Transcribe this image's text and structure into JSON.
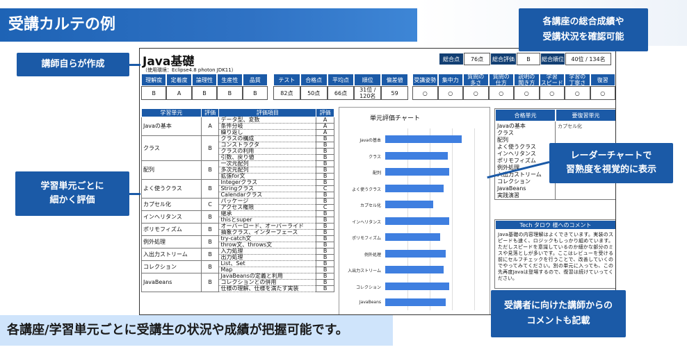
{
  "page": {
    "title": "受講カルテの例",
    "bottom_banner": "各講座/学習単元ごとに受講生の状況や成績が把握可能です。"
  },
  "callouts": {
    "instructor": "講師自らが作成",
    "overall": "各講座の総合成績や\n受講状況を確認可能",
    "per_unit": "学習単元ごとに\n細かく評価",
    "radar": "レーダーチャートで\n習熟度を視覚的に表示",
    "comment": "受講者に向けた講師からの\nコメントも記載"
  },
  "card": {
    "course_title": "Java基礎",
    "env_line": "（使用環境：Eclipse4.8 photon JDK11）",
    "summary": {
      "total_label": "総合点",
      "total_value": "76点",
      "eval_label": "総合評価",
      "eval_value": "B",
      "rank_label": "総合順位",
      "rank_value": "40位 / 134名"
    },
    "group1": {
      "headers": [
        "理解度",
        "定着度",
        "論理性",
        "生産性",
        "品質"
      ],
      "values": [
        "B",
        "A",
        "B",
        "B",
        "B"
      ]
    },
    "group2": {
      "headers": [
        "テスト",
        "合格点",
        "平均点",
        "順位",
        "偏差値"
      ],
      "values": [
        "82点",
        "50点",
        "66点",
        "31位 / 120名",
        "59"
      ]
    },
    "group3": {
      "headers": [
        "受講姿勢",
        "集中力",
        "質問の\n多さ",
        "質問の\n仕方",
        "説明の\n聞き方",
        "学習\nスピード",
        "学習の\n丁寧さ",
        "復習"
      ],
      "values": [
        "○",
        "○",
        "○",
        "○",
        "○",
        "○",
        "○",
        "○"
      ]
    },
    "units_table": {
      "headers": [
        "学習単元",
        "評価",
        "評価項目",
        "評価"
      ],
      "rows": [
        {
          "unit": "Javaの基本",
          "grade": "A",
          "items": [
            [
              "データ型、変数",
              "A"
            ],
            [
              "条件分岐",
              "A"
            ],
            [
              "繰り返し",
              "A"
            ]
          ]
        },
        {
          "unit": "クラス",
          "grade": "B",
          "items": [
            [
              "クラスの構成",
              "B"
            ],
            [
              "コンストラクタ",
              "B"
            ],
            [
              "クラスの利用",
              "B"
            ],
            [
              "引数、戻り値",
              "B"
            ]
          ]
        },
        {
          "unit": "配列",
          "grade": "B",
          "items": [
            [
              "一次元配列",
              "B"
            ],
            [
              "多次元配列",
              "B"
            ],
            [
              "拡張for文",
              "B"
            ]
          ]
        },
        {
          "unit": "よく使うクラス",
          "grade": "B",
          "items": [
            [
              "Integerクラス",
              "B"
            ],
            [
              "Stringクラス",
              "C"
            ],
            [
              "Calendarクラス",
              "B"
            ]
          ]
        },
        {
          "unit": "カプセル化",
          "grade": "C",
          "items": [
            [
              "パッケージ",
              "B"
            ],
            [
              "アクセス権限",
              "C"
            ]
          ]
        },
        {
          "unit": "インヘリタンス",
          "grade": "B",
          "items": [
            [
              "継承",
              "B"
            ],
            [
              "thisとsuper",
              "B"
            ]
          ]
        },
        {
          "unit": "ポリモフィズム",
          "grade": "B",
          "items": [
            [
              "オーバーロード、オーバーライド",
              "B"
            ],
            [
              "抽象クラス、インターフェース",
              "B"
            ]
          ]
        },
        {
          "unit": "例外処理",
          "grade": "B",
          "items": [
            [
              "try-catch文",
              "B"
            ],
            [
              "throw文、throws文",
              "B"
            ]
          ]
        },
        {
          "unit": "入出力ストリーム",
          "grade": "B",
          "items": [
            [
              "入力処理",
              "B"
            ],
            [
              "出力処理",
              "B"
            ]
          ]
        },
        {
          "unit": "コレクション",
          "grade": "B",
          "items": [
            [
              "List、Set",
              "B"
            ],
            [
              "Map",
              "B"
            ]
          ]
        },
        {
          "unit": "JavaBeans",
          "grade": "B",
          "items": [
            [
              "JavaBeansの定義と利用",
              "B"
            ],
            [
              "コレクションとの併用",
              "B"
            ],
            [
              "仕様の理解、仕様を満たす実装",
              "B"
            ]
          ]
        }
      ]
    },
    "pass_table": {
      "headers": [
        "合格単元",
        "要復習単元"
      ],
      "passed": [
        "Javaの基本",
        "クラス",
        "配列",
        "よく使うクラス",
        "インヘリタンス",
        "ポリモフィズム",
        "例外処理",
        "入出力ストリーム",
        "コレクション",
        "JavaBeans",
        "実践演習"
      ],
      "review": [
        "カプセル化"
      ]
    },
    "comment": {
      "header": "Tech タロウ 様へのコメント",
      "body": "Java基礎の内容理解はよくできています。実装のスピードも速く、ロジックもしっかり組めています。ただしスピードを意識しているのか細かな部分のミスや見落としが多いです。ここはレビューを受ける前にセルフチェックを行うことで、改善していくのでやってみてください。別の単元に入っても、この先再度Javaは登場するので、復習は続けていってください。"
    }
  },
  "chart_data": {
    "type": "bar",
    "title": "単元評価チャート",
    "categories": [
      "Javaの基本",
      "クラス",
      "配列",
      "よく使うクラス",
      "カプセル化",
      "インヘリタンス",
      "ポリモフィズム",
      "例外処理",
      "入出力ストリーム",
      "コレクション",
      "JavaBeans"
    ],
    "values": [
      4.3,
      3.5,
      3.6,
      3.3,
      2.7,
      3.6,
      3.1,
      3.4,
      3.3,
      3.6,
      3.4
    ],
    "xlim": [
      0,
      5
    ],
    "grid": true,
    "bar_color": "#3f7fe0"
  },
  "colors": {
    "accent": "#1b5aa7",
    "banner": "#cfe4fb",
    "bar": "#3f7fe0"
  }
}
